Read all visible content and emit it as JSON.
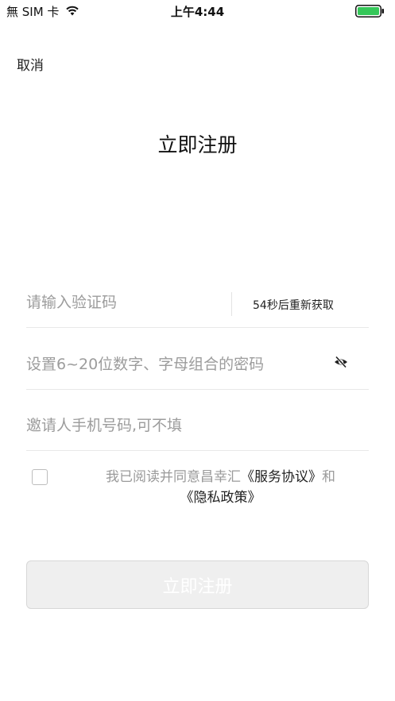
{
  "status_bar": {
    "carrier": "無 SIM 卡",
    "time": "上午4:44",
    "battery_color": "#35c759"
  },
  "nav": {
    "cancel_label": "取消",
    "title": "立即注册"
  },
  "form": {
    "code_placeholder": "请输入验证码",
    "resend_label": "54秒后重新获取",
    "password_placeholder": "设置6~20位数字、字母组合的密码",
    "invite_placeholder": "邀请人手机号码,可不填"
  },
  "agreement": {
    "prefix": "我已阅读并同意昌幸汇",
    "service_link": "《服务协议》",
    "and": "和",
    "privacy_link": "《隐私政策》",
    "checked": false
  },
  "submit_label": "立即注册",
  "icons": {
    "wifi": "wifi-icon",
    "battery": "battery-icon",
    "eye": "eye-slash-icon",
    "checkbox": "checkbox-icon"
  }
}
